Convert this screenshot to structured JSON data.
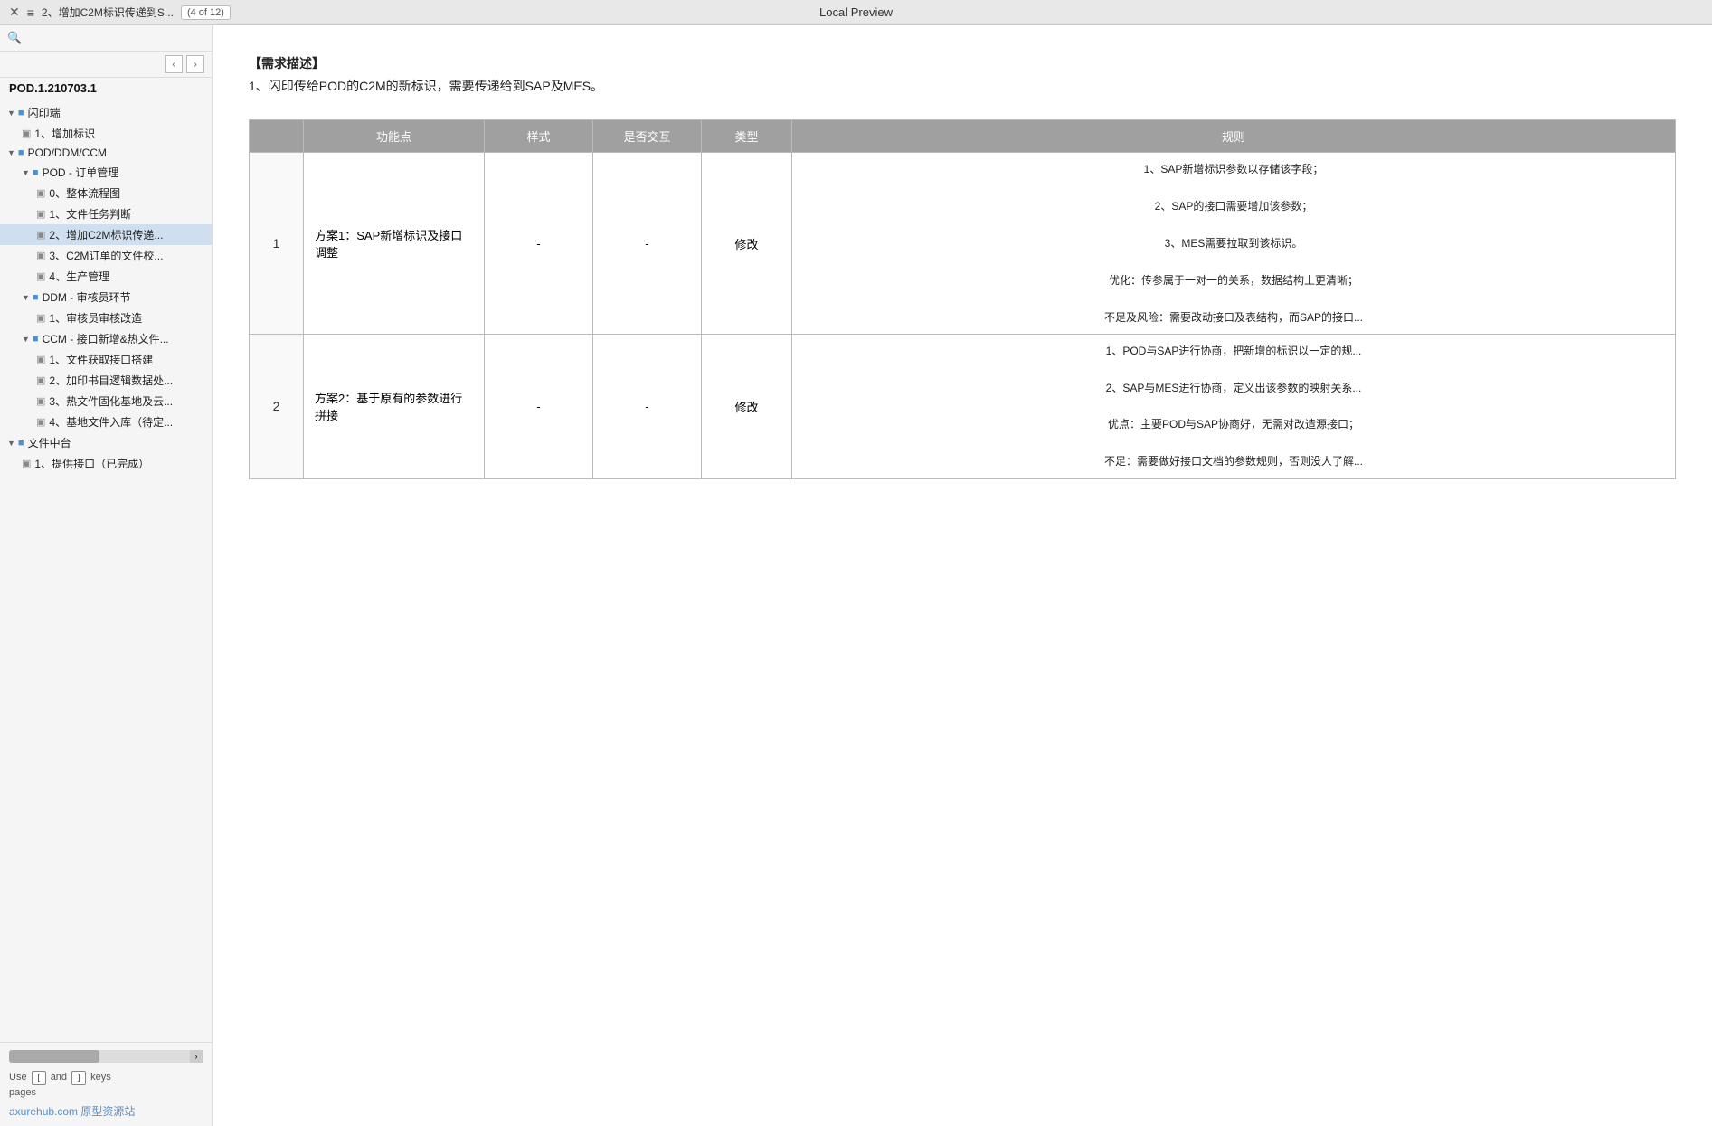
{
  "topbar": {
    "icon": "≡",
    "title": "2、增加C2M标识传递到S...",
    "page_info": "(4 of 12)",
    "preview_label": "Local Preview"
  },
  "sidebar": {
    "search_placeholder": "",
    "root_label": "POD.1.210703.1",
    "nav_prev": "‹",
    "nav_next": "›",
    "tree": [
      {
        "type": "section",
        "level": 0,
        "icon": "▼",
        "folder_color": "#4a90d9",
        "label": "闪印端",
        "indent": 0
      },
      {
        "type": "page",
        "level": 1,
        "label": "1、增加标识",
        "indent": 16,
        "active": false
      },
      {
        "type": "section",
        "level": 0,
        "icon": "▼",
        "folder_color": "#4a90d9",
        "label": "POD/DDM/CCM",
        "indent": 0
      },
      {
        "type": "section",
        "level": 1,
        "icon": "▼",
        "folder_color": "#4a90d9",
        "label": "POD - 订单管理",
        "indent": 16
      },
      {
        "type": "page",
        "level": 2,
        "label": "0、整体流程图",
        "indent": 32,
        "active": false
      },
      {
        "type": "page",
        "level": 2,
        "label": "1、文件任务判断",
        "indent": 32,
        "active": false
      },
      {
        "type": "page",
        "level": 2,
        "label": "2、增加C2M标识传递...",
        "indent": 32,
        "active": true
      },
      {
        "type": "page",
        "level": 2,
        "label": "3、C2M订单的文件校...",
        "indent": 32,
        "active": false
      },
      {
        "type": "page",
        "level": 2,
        "label": "4、生产管理",
        "indent": 32,
        "active": false
      },
      {
        "type": "section",
        "level": 1,
        "icon": "▼",
        "folder_color": "#4a90d9",
        "label": "DDM - 审核员环节",
        "indent": 16
      },
      {
        "type": "page",
        "level": 2,
        "label": "1、审核员审核改造",
        "indent": 32,
        "active": false
      },
      {
        "type": "section",
        "level": 1,
        "icon": "▼",
        "folder_color": "#4a90d9",
        "label": "CCM - 接口新增&热文件...",
        "indent": 16
      },
      {
        "type": "page",
        "level": 2,
        "label": "1、文件获取接口搭建",
        "indent": 32,
        "active": false
      },
      {
        "type": "page",
        "level": 2,
        "label": "2、加印书目逻辑数据处...",
        "indent": 32,
        "active": false
      },
      {
        "type": "page",
        "level": 2,
        "label": "3、热文件固化基地及云...",
        "indent": 32,
        "active": false
      },
      {
        "type": "page",
        "level": 2,
        "label": "4、基地文件入库（待定...",
        "indent": 32,
        "active": false
      },
      {
        "type": "section",
        "level": 0,
        "icon": "▼",
        "folder_color": "#4a90d9",
        "label": "文件中台",
        "indent": 0
      },
      {
        "type": "page",
        "level": 1,
        "label": "1、提供接口（已完成）",
        "indent": 16,
        "active": false
      }
    ],
    "hint": {
      "use": "Use",
      "and": "and",
      "keys": "keys",
      "pages": "pages"
    },
    "watermark": "axurehub.com 原型资源站"
  },
  "content": {
    "description_bold": "【需求描述】",
    "description_text": "1、闪印传给POD的C2M的新标识，需要传递给到SAP及MES。",
    "table": {
      "headers": [
        "",
        "功能点",
        "样式",
        "是否交互",
        "类型",
        "规则"
      ],
      "rows": [
        {
          "num": "1",
          "func": "方案1：SAP新增标识及接口调整",
          "style": "-",
          "interact": "-",
          "type": "修改",
          "rules": "1、SAP新增标识参数以存储该字段；\n\n2、SAP的接口需要增加该参数；\n\n3、MES需要拉取到该标识。\n\n优化：传参属于一对一的关系，数据结构上更清晰；\n\n不足及风险：需要改动接口及表结构，而SAP的接口..."
        },
        {
          "num": "2",
          "func": "方案2：基于原有的参数进行拼接",
          "style": "-",
          "interact": "-",
          "type": "修改",
          "rules": "1、POD与SAP进行协商，把新增的标识以一定的规...\n\n2、SAP与MES进行协商，定义出该参数的映射关系...\n\n优点：主要POD与SAP协商好，无需对改造源接口；\n\n不足：需要做好接口文档的参数规则，否则没人了解..."
        }
      ]
    }
  }
}
